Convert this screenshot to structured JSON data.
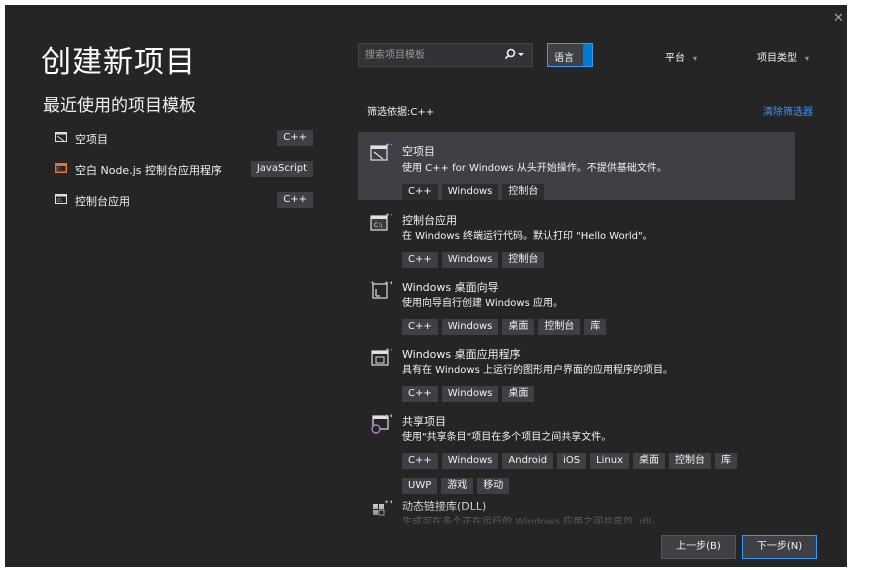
{
  "window": {
    "close_glyph": "✕"
  },
  "title": "创建新项目",
  "recent": {
    "title": "最近使用的项目模板",
    "items": [
      {
        "icon": "empty-project-icon",
        "label": "空项目",
        "tag": "C++"
      },
      {
        "icon": "nodejs-console-icon",
        "label": "空白 Node.js 控制台应用程序",
        "tag": "JavaScript"
      },
      {
        "icon": "console-app-icon",
        "label": "控制台应用",
        "tag": "C++"
      }
    ]
  },
  "search": {
    "placeholder": "搜索项目模板",
    "button_glyph": "⚲▾"
  },
  "filters": {
    "language": "语言",
    "platform": "平台",
    "project_type": "项目类型",
    "chevron": "▾"
  },
  "filter_label": "筛选依据:C++",
  "clear_filter": "清除筛选器",
  "templates": [
    {
      "icon": "empty-project-icon",
      "name": "空项目",
      "desc": "使用 C++ for Windows 从头开始操作。不提供基础文件。",
      "tags": [
        "C++",
        "Windows",
        "控制台"
      ],
      "selected": true
    },
    {
      "icon": "console-app-icon",
      "name": "控制台应用",
      "desc": "在 Windows 终端运行代码。默认打印 \"Hello World\"。",
      "tags": [
        "C++",
        "Windows",
        "控制台"
      ],
      "selected": false
    },
    {
      "icon": "wizard-icon",
      "name": "Windows 桌面向导",
      "desc": "使用向导自行创建 Windows 应用。",
      "tags": [
        "C++",
        "Windows",
        "桌面",
        "控制台",
        "库"
      ],
      "selected": false
    },
    {
      "icon": "desktop-app-icon",
      "name": "Windows 桌面应用程序",
      "desc": "具有在 Windows 上运行的图形用户界面的应用程序的项目。",
      "tags": [
        "C++",
        "Windows",
        "桌面"
      ],
      "selected": false
    },
    {
      "icon": "shared-project-icon",
      "name": "共享项目",
      "desc": "使用\"共享条目\"项目在多个项目之间共享文件。",
      "tags": [
        "C++",
        "Windows",
        "Android",
        "iOS",
        "Linux",
        "桌面",
        "控制台",
        "库",
        "UWP",
        "游戏",
        "移动"
      ],
      "selected": false
    },
    {
      "icon": "dll-icon",
      "name": "动态链接库(DLL)",
      "desc": "生成可在多个正在运行的 Windows 应用之间共享的 .dll。",
      "tags": [],
      "selected": false
    }
  ],
  "buttons": {
    "back": "上一步(B)",
    "next": "下一步(N)"
  },
  "colors": {
    "background": "#252526",
    "accent": "#3399ff",
    "link": "#3794ff",
    "tag": "#3f3f46"
  }
}
